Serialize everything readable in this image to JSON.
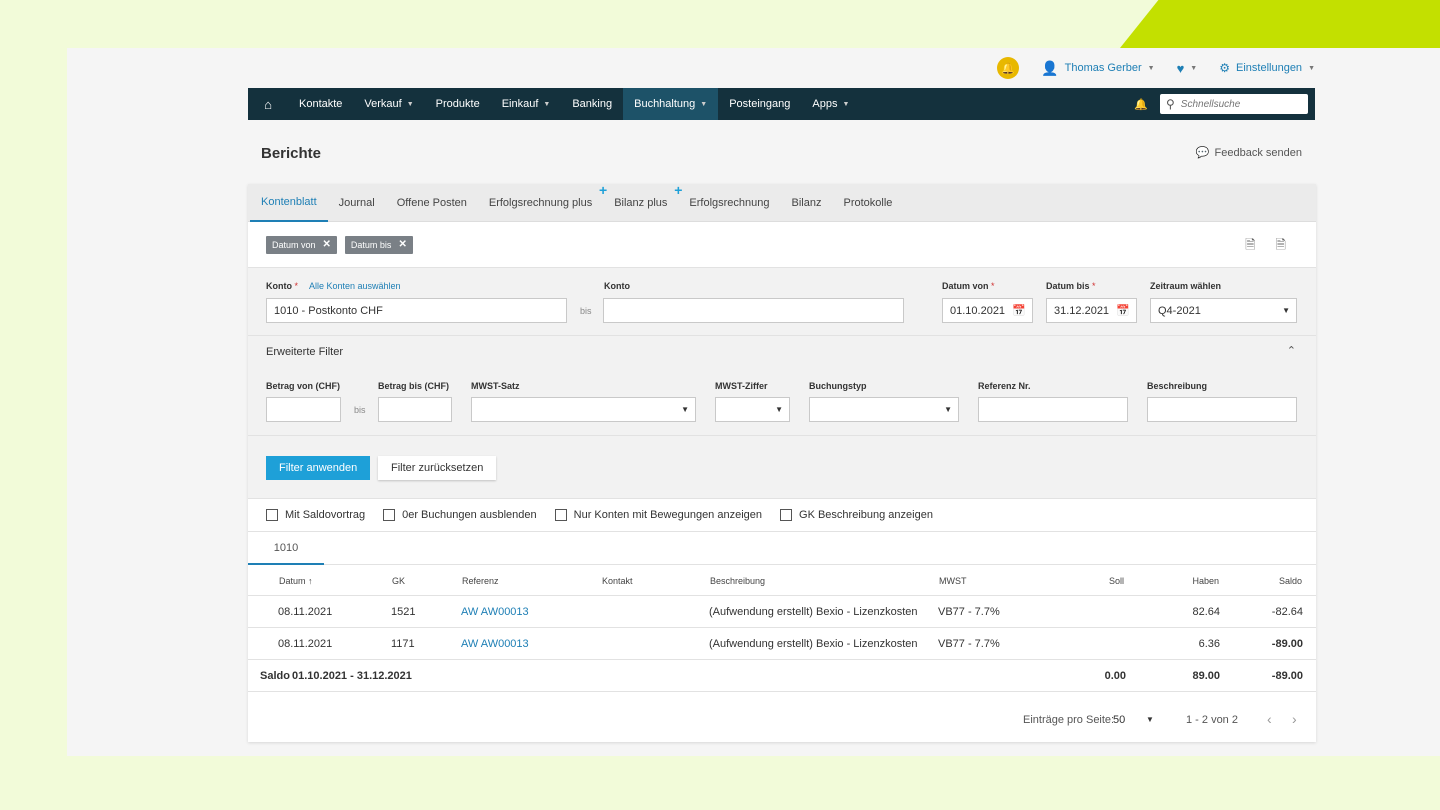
{
  "user_bar": {
    "user_name": "Thomas Gerber",
    "settings_label": "Einstellungen"
  },
  "nav": {
    "items": [
      {
        "label": "Kontakte",
        "dropdown": false
      },
      {
        "label": "Verkauf",
        "dropdown": true
      },
      {
        "label": "Produkte",
        "dropdown": false
      },
      {
        "label": "Einkauf",
        "dropdown": true
      },
      {
        "label": "Banking",
        "dropdown": false
      },
      {
        "label": "Buchhaltung",
        "dropdown": true,
        "active": true
      },
      {
        "label": "Posteingang",
        "dropdown": false
      },
      {
        "label": "Apps",
        "dropdown": true
      }
    ],
    "search_placeholder": "Schnellsuche"
  },
  "page": {
    "title": "Berichte",
    "feedback_label": "Feedback senden"
  },
  "tabs": [
    {
      "label": "Kontenblatt",
      "active": true,
      "plus": false
    },
    {
      "label": "Journal",
      "plus": false
    },
    {
      "label": "Offene Posten",
      "plus": false
    },
    {
      "label": "Erfolgsrechnung plus",
      "plus": true
    },
    {
      "label": "Bilanz plus",
      "plus": true
    },
    {
      "label": "Erfolgsrechnung",
      "plus": false
    },
    {
      "label": "Bilanz",
      "plus": false
    },
    {
      "label": "Protokolle",
      "plus": false
    }
  ],
  "chips": [
    "Datum von",
    "Datum bis"
  ],
  "filters": {
    "konto_label": "Konto",
    "alle_konten_link": "Alle Konten auswählen",
    "konto_value": "1010 - Postkonto CHF",
    "bis": "bis",
    "konto2_label": "Konto",
    "konto2_value": "",
    "datum_von_label": "Datum von",
    "datum_von_value": "01.10.2021",
    "datum_bis_label": "Datum bis",
    "datum_bis_value": "31.12.2021",
    "zeitraum_label": "Zeitraum wählen",
    "zeitraum_value": "Q4-2021"
  },
  "advanced": {
    "title": "Erweiterte Filter",
    "betrag_von_label": "Betrag von (CHF)",
    "betrag_bis_label": "Betrag bis (CHF)",
    "bis": "bis",
    "mwst_satz_label": "MWST-Satz",
    "mwst_ziffer_label": "MWST-Ziffer",
    "buchungstyp_label": "Buchungstyp",
    "referenz_label": "Referenz Nr.",
    "beschreibung_label": "Beschreibung"
  },
  "buttons": {
    "apply": "Filter anwenden",
    "reset": "Filter zurücksetzen"
  },
  "checkboxes": [
    "Mit Saldovortrag",
    "0er Buchungen ausblenden",
    "Nur Konten mit Bewegungen anzeigen",
    "GK Beschreibung anzeigen"
  ],
  "account_tab": "1010",
  "table": {
    "headers": {
      "datum": "Datum",
      "gk": "GK",
      "referenz": "Referenz",
      "kontakt": "Kontakt",
      "beschreibung": "Beschreibung",
      "mwst": "MWST",
      "soll": "Soll",
      "haben": "Haben",
      "saldo": "Saldo"
    },
    "rows": [
      {
        "datum": "08.11.2021",
        "gk": "1521",
        "referenz": "AW AW00013",
        "kontakt": "",
        "beschreibung": "(Aufwendung erstellt) Bexio - Lizenzkosten",
        "mwst": "VB77 - 7.7%",
        "soll": "",
        "haben": "82.64",
        "saldo": "-82.64"
      },
      {
        "datum": "08.11.2021",
        "gk": "1171",
        "referenz": "AW AW00013",
        "kontakt": "",
        "beschreibung": "(Aufwendung erstellt) Bexio - Lizenzkosten",
        "mwst": "VB77 - 7.7%",
        "soll": "",
        "haben": "6.36",
        "saldo": "-89.00"
      }
    ],
    "summary": {
      "label": "Saldo",
      "period": "01.10.2021 - 31.12.2021",
      "soll": "0.00",
      "haben": "89.00",
      "saldo": "-89.00"
    }
  },
  "pager": {
    "label": "Einträge pro Seite:",
    "per_page": "50",
    "count": "1 - 2 von 2"
  }
}
